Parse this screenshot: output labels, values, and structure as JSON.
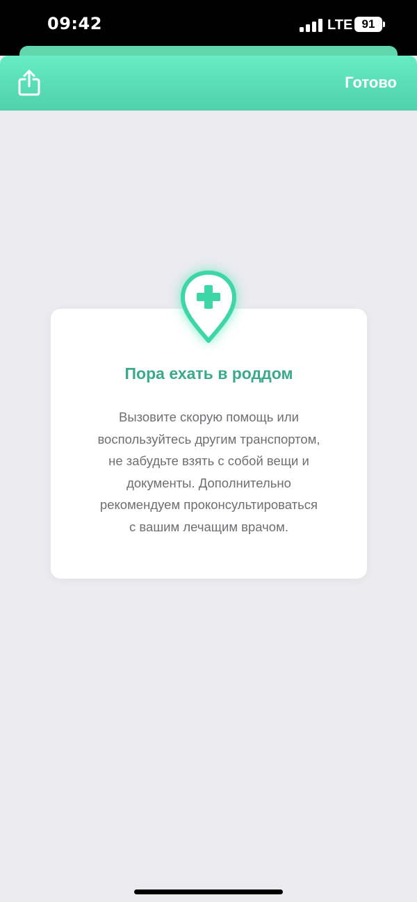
{
  "status_bar": {
    "time": "09:42",
    "network": "LTE",
    "battery": "91"
  },
  "header": {
    "done_label": "Готово",
    "share_icon": "share-icon"
  },
  "card": {
    "icon": "map-pin-medical-cross-icon",
    "title": "Пора ехать в роддом",
    "text": "Вызовите скорую помощь или\nвоспользуйтесь другим транспортом,\nне забудьте взять с собой вещи и\nдокументы. Дополнительно\nрекомендуем проконсультироваться\nс вашим лечащим врачом."
  },
  "colors": {
    "accent": "#4fd1ac",
    "title": "#3aa98c",
    "background": "#ebebf0"
  }
}
